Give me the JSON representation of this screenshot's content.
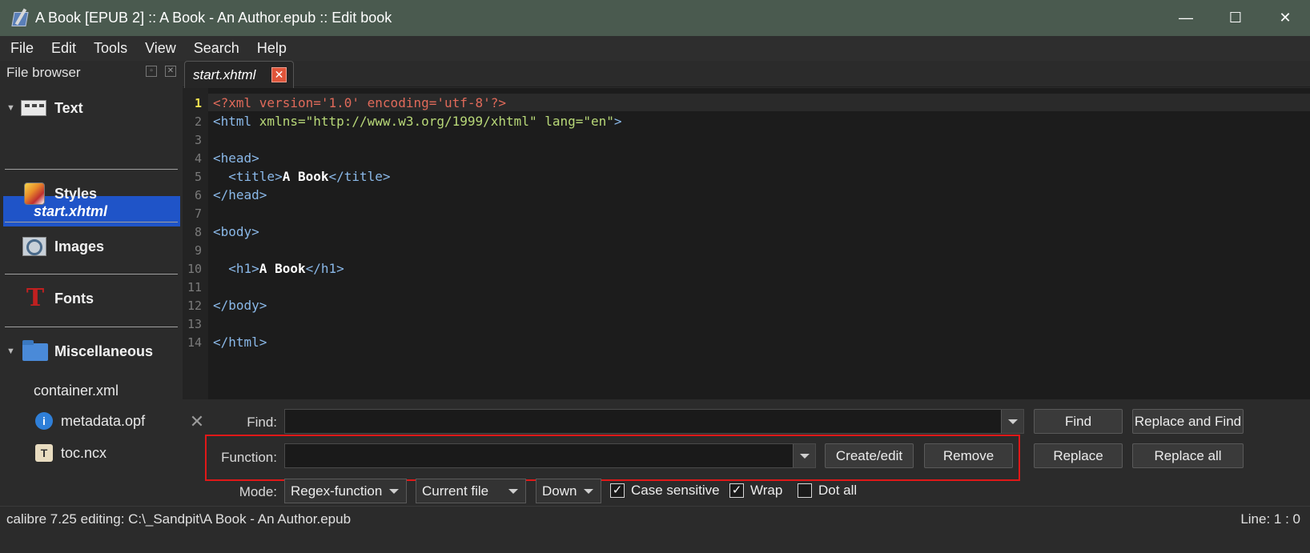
{
  "window": {
    "title": "A Book [EPUB 2] :: A Book - An Author.epub :: Edit book",
    "minimize_glyph": "—",
    "maximize_glyph": "☐",
    "close_glyph": "✕"
  },
  "menu": [
    "File",
    "Edit",
    "Tools",
    "View",
    "Search",
    "Help"
  ],
  "file_browser": {
    "title": "File browser",
    "categories": {
      "text": "Text",
      "styles": "Styles",
      "images": "Images",
      "fonts": "Fonts",
      "misc": "Miscellaneous"
    },
    "selected_file": "start.xhtml",
    "misc_files": [
      "container.xml",
      "metadata.opf",
      "toc.ncx"
    ]
  },
  "editor": {
    "tab_label": "start.xhtml",
    "line_numbers": [
      "1",
      "2",
      "3",
      "4",
      "5",
      "6",
      "7",
      "8",
      "9",
      "10",
      "11",
      "12",
      "13",
      "14"
    ],
    "lines": {
      "l1": "<?xml version='1.0' encoding='utf-8'?>",
      "l2_open": "<html ",
      "l2_attr1": "xmlns=",
      "l2_val1": "\"http://www.w3.org/1999/xhtml\"",
      "l2_attr2": " lang=",
      "l2_val2": "\"en\"",
      "l2_close": ">",
      "l4": "<head>",
      "l5_open": "  <title>",
      "l5_text": "A Book",
      "l5_close": "</title>",
      "l6": "</head>",
      "l8": "<body>",
      "l10_open": "  <h1>",
      "l10_text": "A Book",
      "l10_close": "</h1>",
      "l12": "</body>",
      "l14": "</html>"
    }
  },
  "search": {
    "find_label": "Find:",
    "function_label": "Function:",
    "mode_label": "Mode:",
    "find_value": "",
    "function_value": "",
    "buttons": {
      "find": "Find",
      "replace_and_find": "Replace and Find",
      "create_edit": "Create/edit",
      "remove": "Remove",
      "replace": "Replace",
      "replace_all": "Replace all"
    },
    "mode_value": "Regex-function",
    "scope_value": "Current file",
    "direction_value": "Down",
    "case_sensitive": {
      "label": "Case sensitive",
      "checked": true
    },
    "wrap": {
      "label": "Wrap",
      "checked": true
    },
    "dot_all": {
      "label": "Dot all",
      "checked": false
    },
    "highlight_color": "#e01818"
  },
  "status": {
    "left": "calibre 7.25 editing: C:\\_Sandpit\\A Book - An Author.epub",
    "right": "Line: 1 : 0"
  }
}
